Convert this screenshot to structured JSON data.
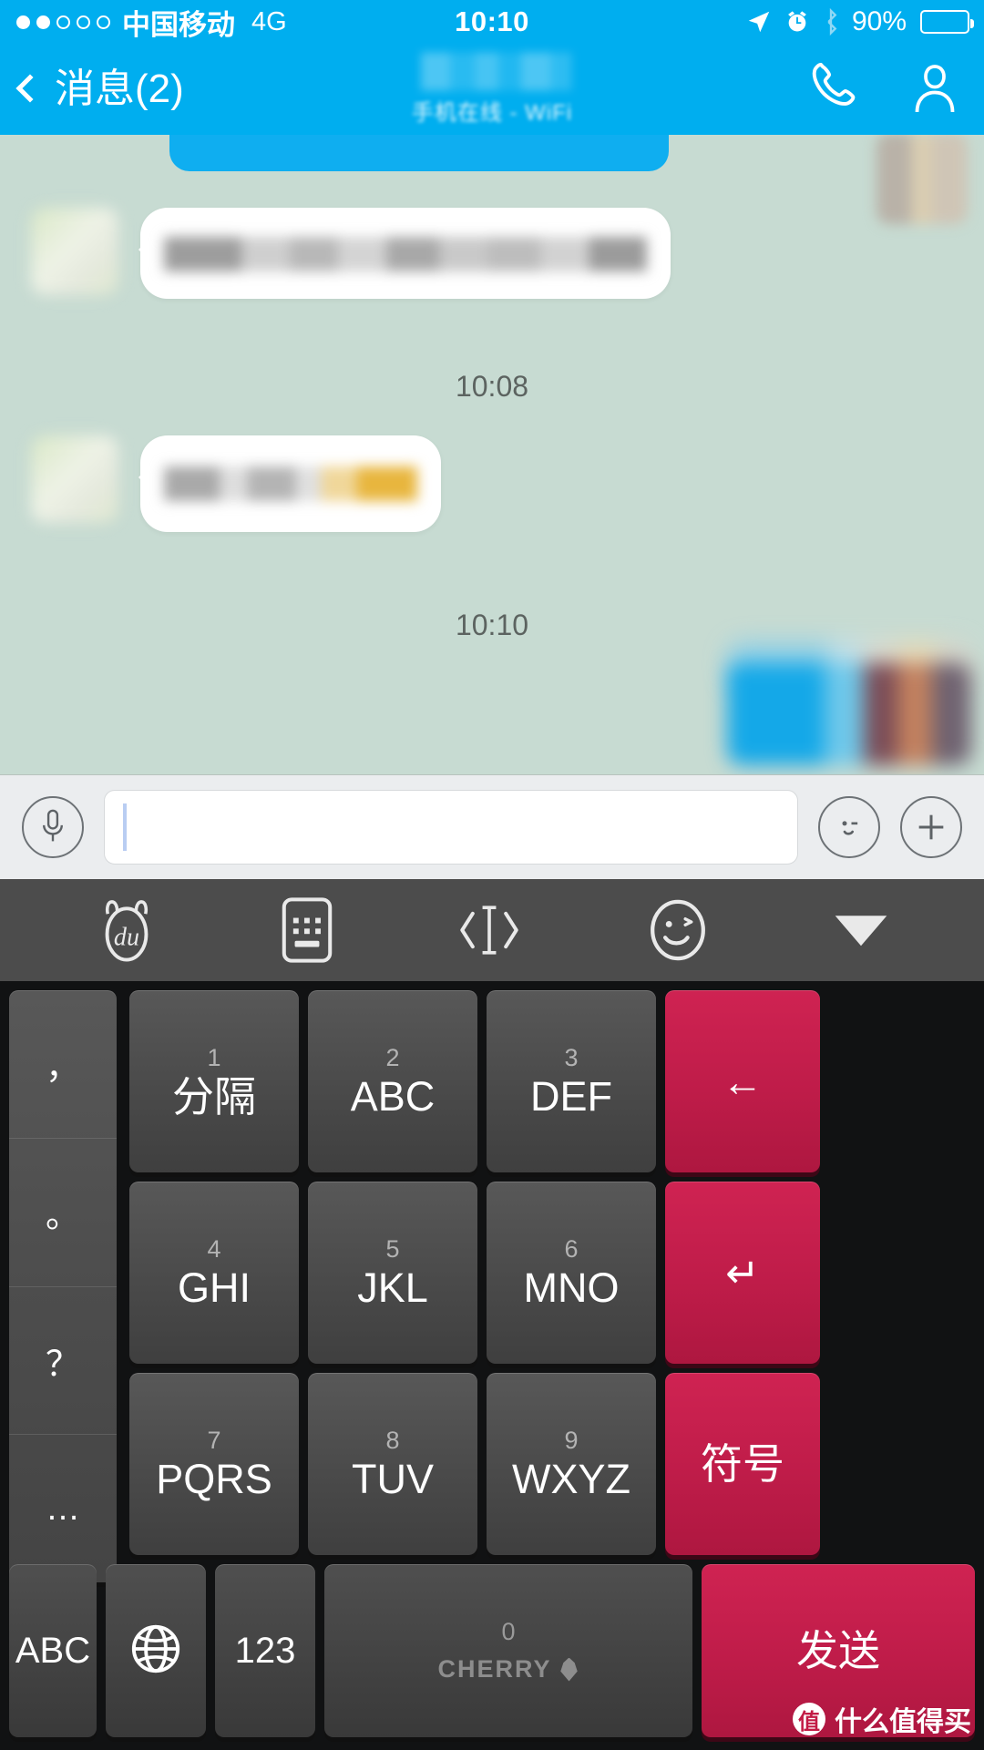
{
  "status_bar": {
    "signal_dots_filled": 2,
    "signal_dots_total": 5,
    "carrier": "中国移动",
    "network": "4G",
    "time": "10:10",
    "battery_percent": "90%",
    "icons": [
      "location-arrow-icon",
      "alarm-clock-icon",
      "bluetooth-icon",
      "battery-icon"
    ]
  },
  "nav_bar": {
    "back_label": "消息(2)",
    "contact_name": "",
    "subtitle": "手机在线 - WiFi",
    "actions": [
      "phone-call-icon",
      "profile-icon"
    ],
    "background_color": "#00aeef"
  },
  "chat": {
    "background_color": "#c7dbd2",
    "messages": [
      {
        "id": "m1",
        "side": "outgoing",
        "type": "text",
        "text": "",
        "redacted": true
      },
      {
        "id": "m2",
        "side": "incoming",
        "type": "text",
        "text": "",
        "redacted": true
      },
      {
        "id": "m3",
        "side": "incoming",
        "type": "text",
        "text": "",
        "redacted": true
      },
      {
        "id": "m4",
        "side": "outgoing",
        "type": "image",
        "text": "",
        "redacted": true
      }
    ],
    "timestamps": [
      "10:08",
      "10:10"
    ]
  },
  "input_bar": {
    "voice_icon": "microphone-icon",
    "text_value": "",
    "placeholder": "",
    "emoji_icon": "emoji-wink-icon",
    "more_icon": "plus-icon",
    "background_color": "#ebedef"
  },
  "keyboard": {
    "toolbar": [
      {
        "name": "baidu-logo-icon",
        "label": "du"
      },
      {
        "name": "keyboard-switch-icon",
        "label": ""
      },
      {
        "name": "cursor-move-icon",
        "label": ""
      },
      {
        "name": "emoji-smiley-icon",
        "label": ""
      },
      {
        "name": "collapse-keyboard-icon",
        "label": ""
      }
    ],
    "punctuation": [
      "，",
      "。",
      "？",
      "…"
    ],
    "keys": [
      {
        "num": "1",
        "label": "分隔",
        "cn": true
      },
      {
        "num": "2",
        "label": "ABC",
        "cn": false
      },
      {
        "num": "3",
        "label": "DEF",
        "cn": false
      },
      {
        "num": "4",
        "label": "GHI",
        "cn": false
      },
      {
        "num": "5",
        "label": "JKL",
        "cn": false
      },
      {
        "num": "6",
        "label": "MNO",
        "cn": false
      },
      {
        "num": "7",
        "label": "PQRS",
        "cn": false
      },
      {
        "num": "8",
        "label": "TUV",
        "cn": false
      },
      {
        "num": "9",
        "label": "WXYZ",
        "cn": false
      }
    ],
    "function_keys": {
      "backspace": "←",
      "enter": "↵",
      "symbols": "符号"
    },
    "bottom_row": {
      "abc": "ABC",
      "globe": "globe-icon",
      "numbers": "123",
      "space_num": "0",
      "space_brand": "CHERRY",
      "send": "发送"
    },
    "accent_color": "#c21b4b",
    "key_color": "#4a4a4a",
    "toolbar_color": "#4c4c4c"
  },
  "watermark": {
    "badge": "值",
    "text": "什么值得买"
  }
}
